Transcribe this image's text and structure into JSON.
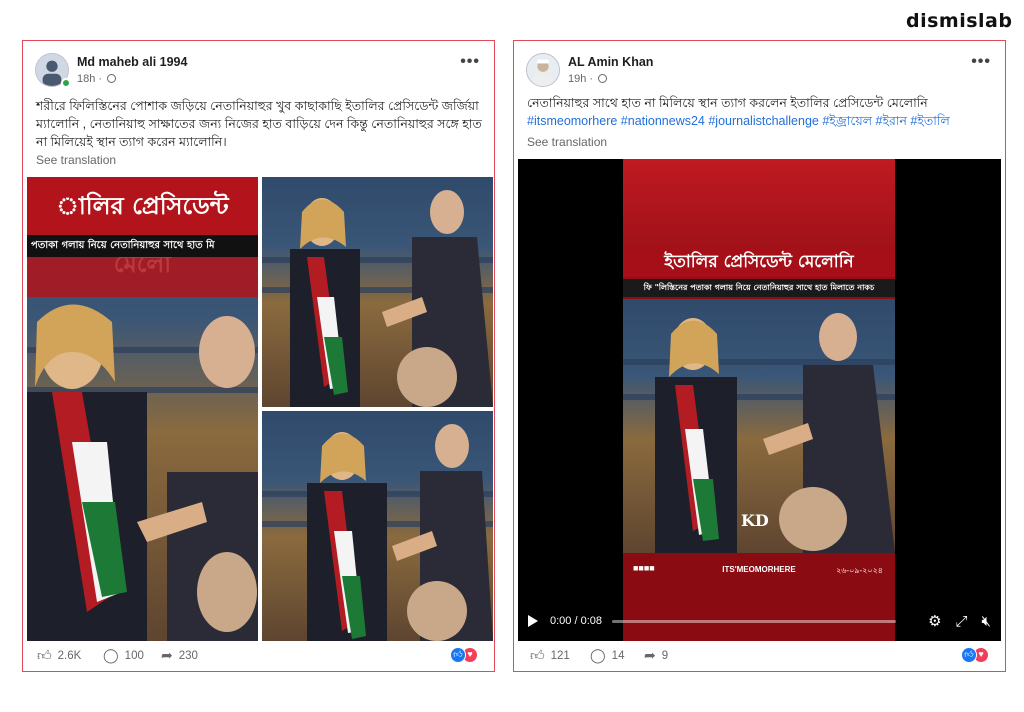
{
  "brand": "dismislab",
  "posts": [
    {
      "author": "Md maheb ali 1994",
      "time": "18h ·",
      "text": "শরীরে ফিলিস্তিনের পোশাক জড়িয়ে নেতানিয়াহুর খুব কাছাকাছি ইতালির প্রেসিডেন্ট জর্জিয়া ম্যালোনি , নেতানিয়াহু সাক্ষাতের জন্য নিজের হাত বাড়িয়ে দেন কিন্তু নেতানিয়াহুর সঙ্গে হাত না মিলিয়েই স্থান ত্যাগ করেন ম্যালোনি।",
      "see_translation": "See translation",
      "media": {
        "banner_text": "ালির প্রেসিডেন্ট মেলো",
        "strip_text": "পতাকা গলায় নিয়ে নেতানিয়াহুর সাথে হাত মি"
      },
      "likes": "2.6K",
      "comments": "100",
      "shares": "230"
    },
    {
      "author": "AL Amin Khan",
      "time": "19h ·",
      "text": "নেতানিয়াহুর সাথে হাত না মিলিয়ে  স্থান ত্যাগ করলেন ইতালির প্রেসিডেন্ট মেলোনি",
      "hashtags": "#itsmeomorhere #nationnews24 #journalistchallenge #ইজ্রায়েল #ইরান #ইতালি",
      "see_translation": "See translation",
      "media": {
        "banner_text": "ইতালির প্রেসিডেন্ট মেলোনি",
        "strip_text": "ফি \"লিস্তিনের পতাকা গলায় নিয়ে নেতানিয়াহুর সাথে হাত মিলাতে নাকচ",
        "watermark": "KD",
        "channel": "ITS'MEOMORHERE",
        "date": "২৬-০৯-২০২৪",
        "time_label": "0:00 / 0:08",
        "progress": 0.0
      },
      "likes": "121",
      "comments": "14",
      "shares": "9"
    }
  ],
  "icons": {
    "like": "thumbs-up-icon",
    "comment": "comment-icon",
    "share": "share-icon",
    "settings": "gear-icon",
    "fullscreen": "expand-icon",
    "mute": "mute-icon",
    "play": "play-icon"
  }
}
